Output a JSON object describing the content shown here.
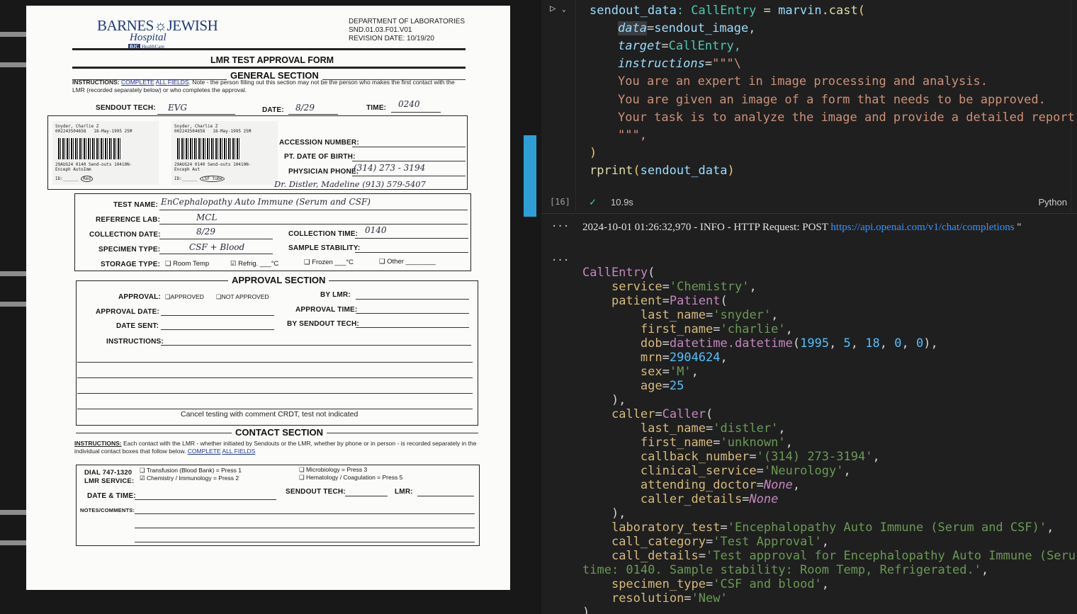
{
  "form": {
    "logo_main": "BARNES☼JEWISH",
    "logo_sub": "Hospital",
    "logo_bjc": "BJC",
    "logo_healthcare": "HealthCare",
    "dept_lines": [
      "DEPARTMENT OF LABORATORIES",
      "SND.01.03.F01.V01",
      "REVISION DATE: 10/19/20"
    ],
    "title": "LMR TEST APPROVAL FORM",
    "general_section": "GENERAL SECTION",
    "general_instructions_prefix": "INSTRUCTIONS:",
    "general_instructions_link1": "COMPLETE",
    "general_instructions_link2": "ALL FIELDS",
    "general_instructions_text": ". Note - the person filling out this section may not be the person who makes the first contact with the LMR (recorded separately below) or who completes the approval.",
    "labels": {
      "sendout_tech": "SENDOUT TECH:",
      "date": "DATE:",
      "time": "TIME:",
      "accession_number": "ACCESSION NUMBER:",
      "pt_dob": "PT. DATE OF BIRTH:",
      "physician_phone": "PHYSICIAN PHONE:",
      "test_name": "TEST NAME:",
      "reference_lab": "REFERENCE LAB:",
      "collection_date": "COLLECTION DATE:",
      "collection_time": "COLLECTION TIME:",
      "specimen_type": "SPECIMEN TYPE:",
      "sample_stability": "SAMPLE STABILITY:",
      "storage_type": "STORAGE TYPE:"
    },
    "handwritten": {
      "sendout_tech": "EVG",
      "date": "8/29",
      "time": "0240",
      "physician_phone": "(314) 273 - 3194",
      "physician_name": "Dr. Distler, Madeline (913) 579-5407",
      "test_name": "EnCephalopathy Auto Immune (Serum and CSF)",
      "reference_lab": "MCL",
      "collection_date": "8/29",
      "collection_time": "0140",
      "specimen_type": "CSF + Blood"
    },
    "storage_options": [
      "❑ Room Temp",
      "☑ Refrig. ___°C",
      "❑ Frozen ___°C",
      "❑ Other ________"
    ],
    "sticker_left": {
      "name": "Snyder, Charlie Z",
      "id": "002243504658",
      "dob": "18-May-1995 25M",
      "line1": "29AUG24 0140 Send-outs 10410N-",
      "line2": "Enceph AutoImm",
      "id_label": "ID:______",
      "tag": "Red"
    },
    "sticker_right": {
      "name": "Snyder, Charlie Z",
      "id": "002243504658",
      "dob": "18-May-1995 25M",
      "line1": "29AUG24 0140 Send-outs 10410N-",
      "line2": "Enceph Aut",
      "id_label": "ID:______",
      "tag": "CSF tube"
    },
    "approval_section": "APPROVAL SECTION",
    "approval_labels": {
      "approval": "APPROVAL:",
      "approved": "❑APPROVED",
      "not_approved": "❑NOT APPROVED",
      "by_lmr": "BY LMR:",
      "approval_date": "APPROVAL DATE:",
      "approval_time": "APPROVAL TIME:",
      "date_sent": "DATE SENT:",
      "by_sendout_tech": "BY SENDOUT TECH:",
      "instructions": "INSTRUCTIONS:"
    },
    "cancel_note": "Cancel testing with comment CRDT, test not indicated",
    "contact_section": "CONTACT SECTION",
    "contact_instructions_prefix": "INSTRUCTIONS:",
    "contact_instructions_text": "Each contact with the LMR - whether initiated by Sendouts or the LMR, whether by phone or in person - is recorded separately in the individual contact boxes that follow below.",
    "contact_link1": "COMPLETE",
    "contact_link2": "ALL FIELDS",
    "dial_label": "DIAL 747-1320",
    "lmr_service_label": "LMR SERVICE:",
    "services": [
      "❑ Transfusion (Blood Bank)  = Press 1",
      "☑ Chemistry / Immunology  = Press 2",
      "❑ Microbiology = Press 3",
      "❑ Hematology / Coagulation =  Press 5"
    ],
    "date_time_label": "DATE & TIME:",
    "contact_sendout_tech": "SENDOUT TECH:",
    "lmr_label": "LMR:",
    "notes_label": "NOTES/COMMENTS:"
  },
  "editor": {
    "exec_count": "[16]",
    "status_time": "10.9s",
    "language": "Python",
    "log_prefix": "2024-10-01 01:26:32,970 - INFO - HTTP Request: POST ",
    "log_url": "https://api.openai.com/v1/chat/completions",
    "log_suffix": " \"",
    "code_lines": {
      "l1_var": "sendout_data",
      "l1_type": ": CallEntry",
      "l1_eq": " = ",
      "l1_obj": "marvin",
      "l1_fn": ".cast",
      "l1_paren": "(",
      "l2_param": "data",
      "l2_val": "sendout_image,",
      "l3_param": "target",
      "l3_val": "CallEntry,",
      "l4_param": "instructions",
      "l4_val": "\"\"\"\\",
      "l5": "You are an expert in image processing and analysis.",
      "l6": "You are given an image of a form that needs to be approved.",
      "l7": "Your task is to analyze the image and provide a detailed report",
      "l8": "\"\"\",",
      "l9": ")",
      "l10_fn": "rprint",
      "l10_arg": "sendout_data"
    },
    "output": {
      "service": "'Chemistry'",
      "last_name": "'snyder'",
      "first_name": "'charlie'",
      "dob_year": "1995",
      "dob_month": "5",
      "dob_day": "18",
      "dob_h": "0",
      "dob_m": "0",
      "mrn": "2904624",
      "sex": "'M'",
      "age": "25",
      "caller_last": "'distler'",
      "caller_first": "'unknown'",
      "callback": "'(314) 273-3194'",
      "clinical_service": "'Neurology'",
      "attending": "None",
      "caller_details": "None",
      "laboratory_test": "'Encephalopathy Auto Immune (Serum and CSF)'",
      "call_category": "'Test Approval'",
      "call_details": "'Test approval for Encephalopathy Auto Immune (Seru",
      "call_details_cont": "time: 0140. Sample stability: Room Temp, Refrigerated.'",
      "specimen_type": "'CSF and blood'",
      "resolution": "'New'"
    }
  }
}
